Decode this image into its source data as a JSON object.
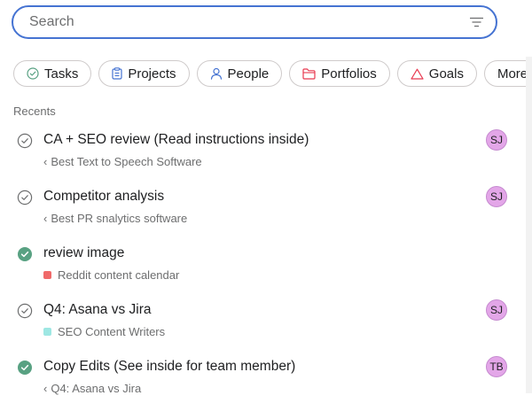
{
  "search": {
    "placeholder": "Search",
    "value": ""
  },
  "filters": [
    {
      "label": "Tasks",
      "icon": "check-circle-icon"
    },
    {
      "label": "Projects",
      "icon": "clipboard-icon"
    },
    {
      "label": "People",
      "icon": "person-icon"
    },
    {
      "label": "Portfolios",
      "icon": "folder-icon"
    },
    {
      "label": "Goals",
      "icon": "triangle-icon"
    },
    {
      "label": "More",
      "icon": ""
    }
  ],
  "recents": {
    "label": "Recents",
    "items": [
      {
        "title": "CA + SEO review (Read instructions inside)",
        "subtitle": "Best Text to Speech Software",
        "status": "incomplete",
        "avatar": "SJ"
      },
      {
        "title": "Competitor analysis",
        "subtitle": "Best PR snalytics software",
        "status": "incomplete",
        "avatar": "SJ"
      },
      {
        "title": "review image",
        "subtitle": "Reddit content calendar",
        "status": "complete",
        "avatar": ""
      },
      {
        "title": "Q4: Asana vs Jira",
        "subtitle": "SEO Content Writers",
        "status": "incomplete",
        "avatar": "SJ"
      },
      {
        "title": "Copy Edits (See inside for team member)",
        "subtitle": "Q4: Asana vs Jira",
        "status": "complete",
        "avatar": "TB"
      }
    ]
  },
  "colors": {
    "accent": "#4573d2",
    "complete": "#58a182",
    "avatar": "#e3a6e8",
    "swatch_red": "#f06a6a",
    "swatch_teal": "#9ee7e3",
    "portfolio_icon": "#e8384f",
    "goal_icon": "#e8384f",
    "tasks_icon": "#58a182",
    "projects_icon": "#4573d2",
    "people_icon": "#4573d2"
  }
}
